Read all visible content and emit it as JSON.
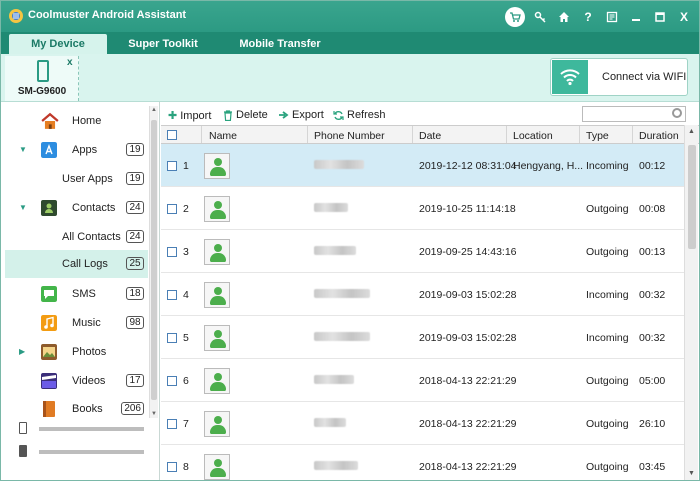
{
  "app": {
    "title": "Coolmuster Android Assistant",
    "title_icons": [
      "cart-icon",
      "key-icon",
      "home-icon",
      "help-icon",
      "feedback-icon",
      "minimize-icon",
      "maximize-icon",
      "close-icon"
    ],
    "help_glyph": "?",
    "close_glyph": "X"
  },
  "nav": {
    "tabs": [
      {
        "label": "My Device",
        "active": true
      },
      {
        "label": "Super Toolkit",
        "active": false
      },
      {
        "label": "Mobile Transfer",
        "active": false
      }
    ]
  },
  "device": {
    "name": "SM-G9600",
    "close_glyph": "x",
    "wifi_label": "Connect via WIFI"
  },
  "sidebar": {
    "items": [
      {
        "label": "Home",
        "count": null,
        "icon": "home-icon",
        "arrow": ""
      },
      {
        "label": "Apps",
        "count": "19",
        "icon": "apps-icon",
        "arrow": "▼"
      },
      {
        "label": "User Apps",
        "count": "19",
        "icon": "",
        "arrow": ""
      },
      {
        "label": "Contacts",
        "count": "24",
        "icon": "contacts-icon",
        "arrow": "▼"
      },
      {
        "label": "All Contacts",
        "count": "24",
        "icon": "",
        "arrow": ""
      },
      {
        "label": "Call Logs",
        "count": "25",
        "icon": "",
        "arrow": "",
        "selected": true
      },
      {
        "label": "SMS",
        "count": "18",
        "icon": "sms-icon",
        "arrow": ""
      },
      {
        "label": "Music",
        "count": "98",
        "icon": "music-icon",
        "arrow": ""
      },
      {
        "label": "Photos",
        "count": null,
        "icon": "photos-icon",
        "arrow": "▶"
      },
      {
        "label": "Videos",
        "count": "17",
        "icon": "videos-icon",
        "arrow": ""
      },
      {
        "label": "Books",
        "count": "206",
        "icon": "books-icon",
        "arrow": ""
      }
    ],
    "storage": [
      "phone-storage-icon",
      "sd-card-icon"
    ]
  },
  "toolbar": {
    "import_label": "Import",
    "delete_label": "Delete",
    "export_label": "Export",
    "refresh_label": "Refresh",
    "search_placeholder": ""
  },
  "table": {
    "columns": [
      "Name",
      "Phone Number",
      "Date",
      "Location",
      "Type",
      "Duration"
    ],
    "rows": [
      {
        "index": "1",
        "date": "2019-12-12 08:31:04",
        "location": "Hengyang, H...",
        "type": "Incoming",
        "duration": "00:12",
        "selected": true
      },
      {
        "index": "2",
        "date": "2019-10-25 11:14:18",
        "location": "",
        "type": "Outgoing",
        "duration": "00:08"
      },
      {
        "index": "3",
        "date": "2019-09-25 14:43:16",
        "location": "",
        "type": "Outgoing",
        "duration": "00:13"
      },
      {
        "index": "4",
        "date": "2019-09-03 15:02:28",
        "location": "",
        "type": "Incoming",
        "duration": "00:32"
      },
      {
        "index": "5",
        "date": "2019-09-03 15:02:28",
        "location": "",
        "type": "Incoming",
        "duration": "00:32"
      },
      {
        "index": "6",
        "date": "2018-04-13 22:21:29",
        "location": "",
        "type": "Outgoing",
        "duration": "05:00"
      },
      {
        "index": "7",
        "date": "2018-04-13 22:21:29",
        "location": "",
        "type": "Outgoing",
        "duration": "26:10"
      },
      {
        "index": "8",
        "date": "2018-04-13 22:21:29",
        "location": "",
        "type": "Outgoing",
        "duration": "03:45"
      }
    ]
  },
  "colors": {
    "titlebar": "#2c9a83",
    "navbar": "#1f8a73",
    "selection_sidebar": "#d4f1ea",
    "selection_row": "#d3ebf6",
    "wifi_accent": "#3eb89c"
  }
}
